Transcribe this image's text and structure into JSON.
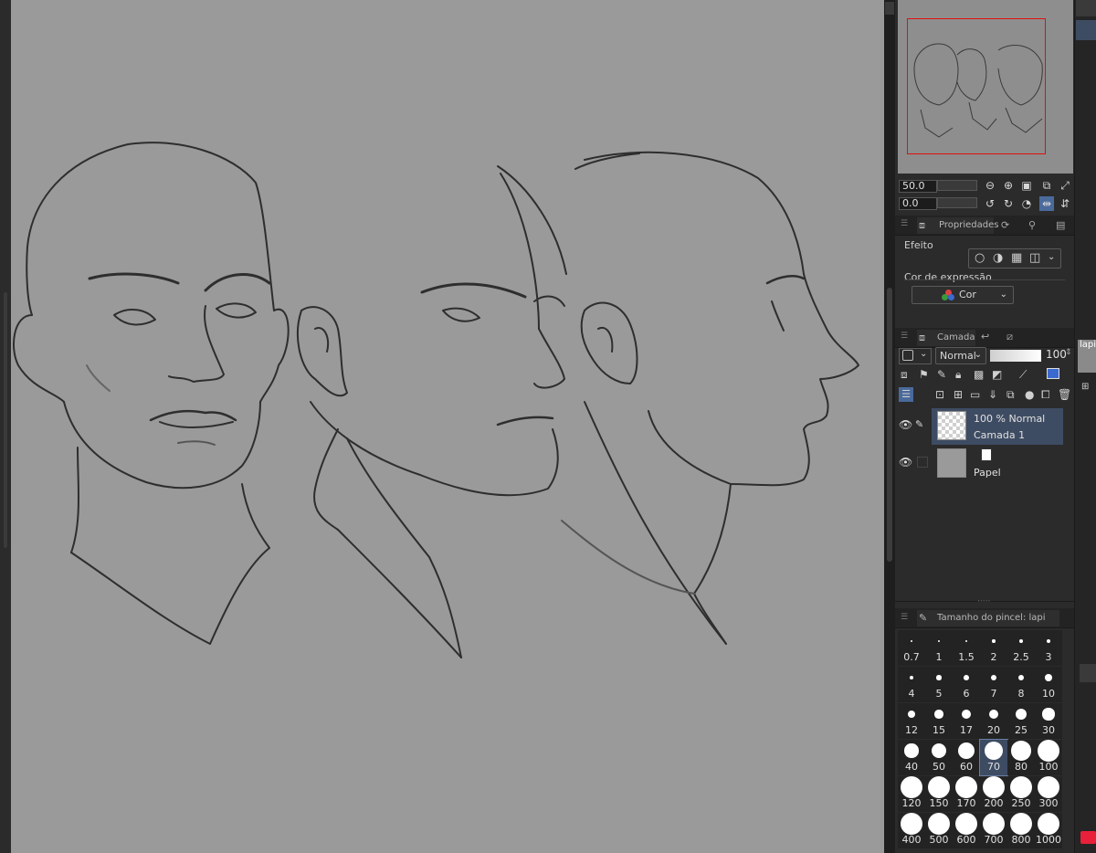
{
  "navigator": {
    "zoom_value": "50.0",
    "rotation_value": "0.0"
  },
  "properties_panel": {
    "tab_label": "Propriedades",
    "effect_label": "Efeito",
    "expression_color_label": "Cor de expressão",
    "expression_color_value": "Cor"
  },
  "layer_panel": {
    "tab_label": "Camada",
    "blend_mode": "Normal",
    "opacity": "100",
    "layers": [
      {
        "info": "100 % Normal",
        "name": "Camada 1"
      },
      {
        "name": "Papel"
      }
    ]
  },
  "brush_size_panel": {
    "title": "Tamanho do pincel: lapi",
    "selected_size": "70",
    "sizes": [
      "0.7",
      "1",
      "1.5",
      "2",
      "2.5",
      "3",
      "4",
      "5",
      "6",
      "7",
      "8",
      "10",
      "12",
      "15",
      "17",
      "20",
      "25",
      "30",
      "40",
      "50",
      "60",
      "70",
      "80",
      "100",
      "120",
      "150",
      "170",
      "200",
      "250",
      "300",
      "400",
      "500",
      "600",
      "700",
      "800",
      "1000"
    ]
  },
  "far_right": {
    "tab_label": "lapi"
  },
  "colors": {
    "canvas": "#9a9a9a",
    "panel": "#2b2b2b",
    "navigator_frame": "#e01010",
    "selected_layer": "#3e4c63",
    "accent_red": "#e8203a"
  }
}
